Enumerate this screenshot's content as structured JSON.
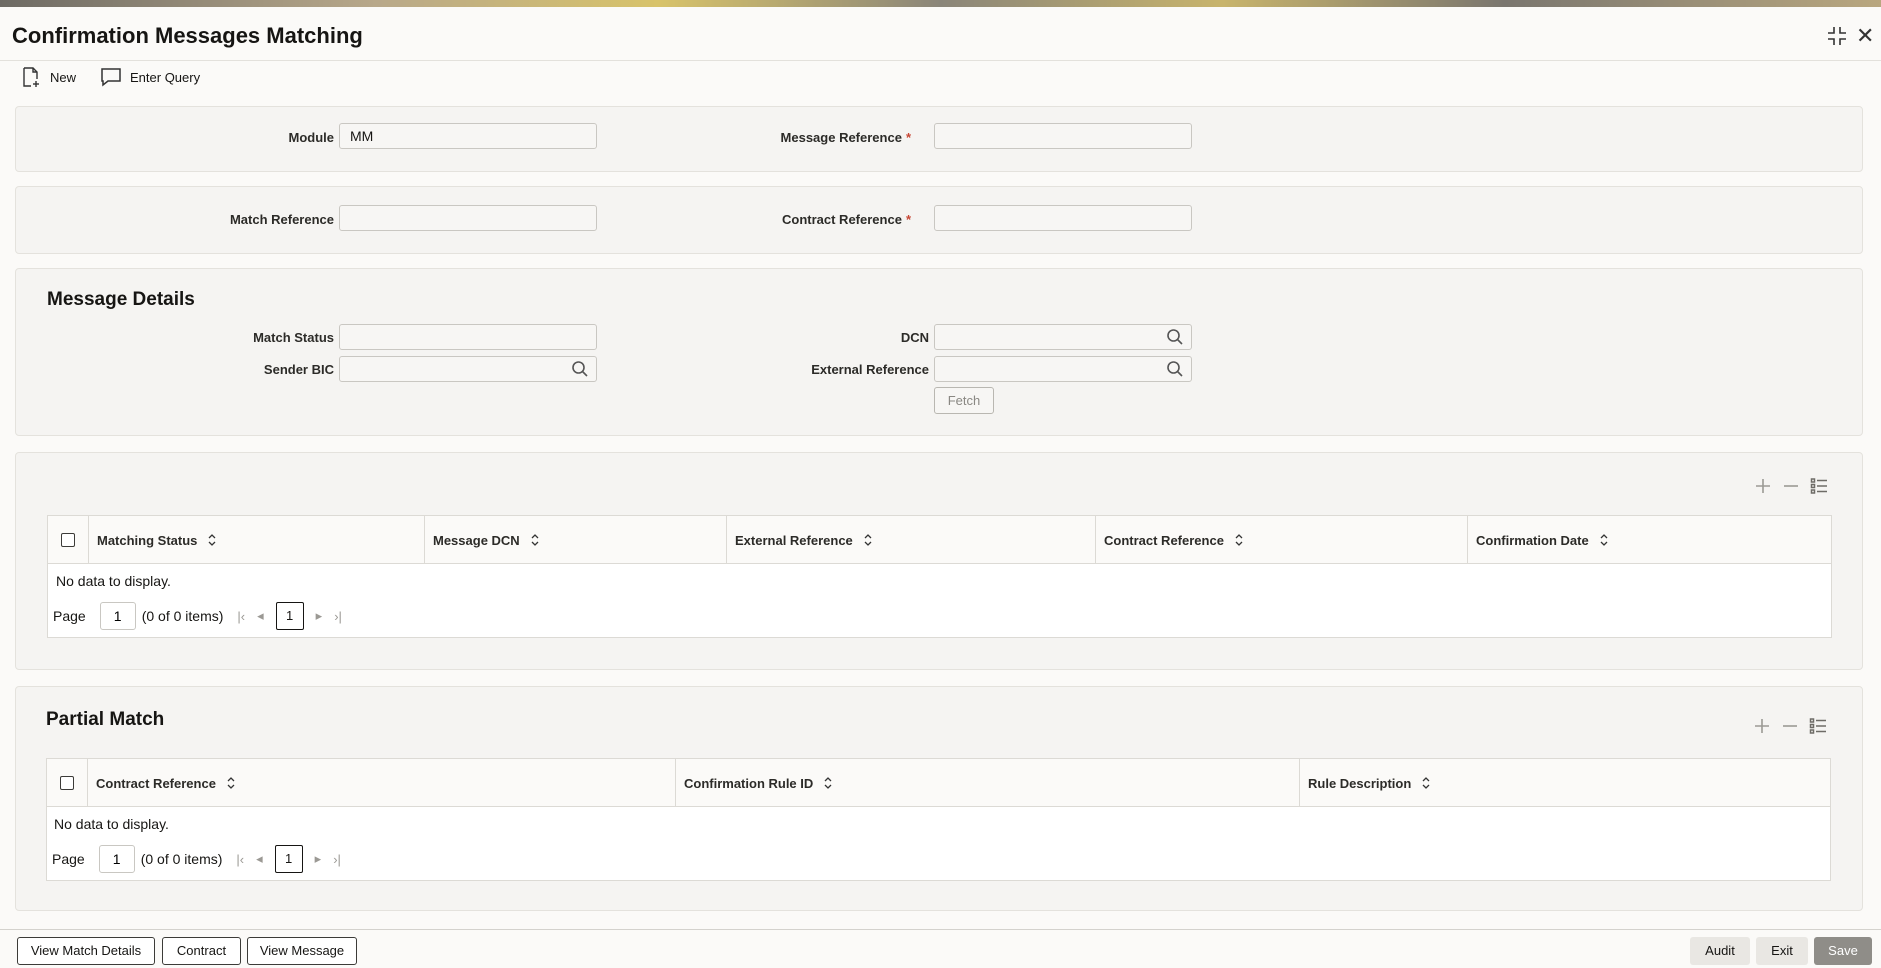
{
  "window": {
    "title": "Confirmation Messages Matching"
  },
  "toolbar": {
    "new_label": "New",
    "enter_query_label": "Enter Query"
  },
  "form": {
    "module_label": "Module",
    "module_value": "MM",
    "message_reference_label": "Message Reference",
    "match_reference_label": "Match Reference",
    "contract_reference_label": "Contract Reference",
    "required_mark": "*"
  },
  "message_details": {
    "title": "Message Details",
    "match_status_label": "Match Status",
    "sender_bic_label": "Sender BIC",
    "dcn_label": "DCN",
    "external_reference_label": "External Reference",
    "fetch_label": "Fetch"
  },
  "messages_grid": {
    "columns": [
      "Matching Status",
      "Message DCN",
      "External Reference",
      "Contract Reference",
      "Confirmation Date"
    ],
    "empty_text": "No data to display.",
    "page_label": "Page",
    "page_value": "1",
    "items_text": "(0 of 0 items)",
    "current_page": "1"
  },
  "partial_match": {
    "title": "Partial Match",
    "columns": [
      "Contract Reference",
      "Confirmation Rule ID",
      "Rule Description"
    ],
    "empty_text": "No data to display.",
    "page_label": "Page",
    "page_value": "1",
    "items_text": "(0 of 0 items)",
    "current_page": "1"
  },
  "footer": {
    "view_match_details": "View Match Details",
    "contract": "Contract",
    "view_message": "View Message",
    "audit": "Audit",
    "exit": "Exit",
    "save": "Save"
  },
  "colors": {
    "required": "#c74634",
    "save_button": "#8f8d88"
  }
}
